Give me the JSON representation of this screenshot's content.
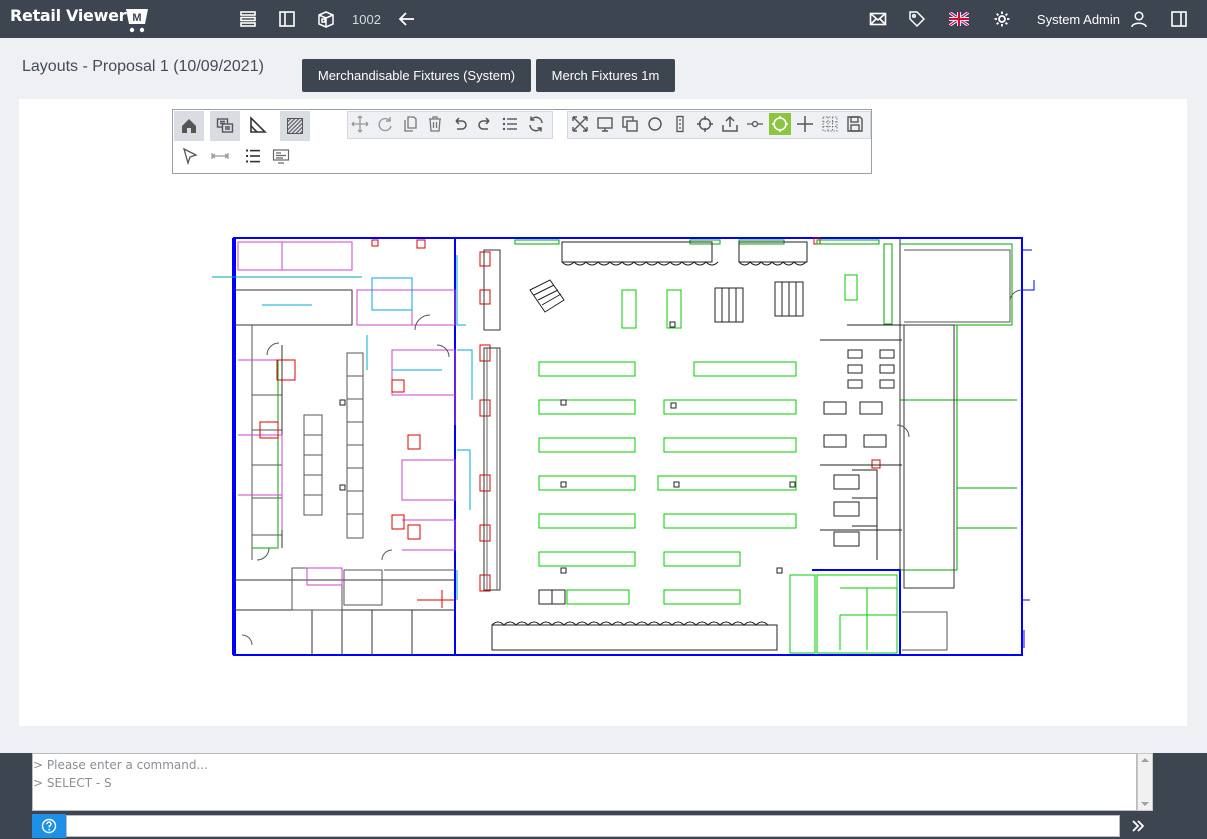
{
  "app": {
    "logo_text": "Retail Viewer",
    "logo_badge": "M",
    "layout_id": "1002",
    "user_name": "System Admin"
  },
  "header": {
    "title": "Layouts - Proposal 1 (10/09/2021)",
    "buttons": [
      "Merchandisable Fixtures (System)",
      "Merch Fixtures 1m"
    ]
  },
  "icons": {
    "top_left": [
      "list-icon",
      "sidebar-panel-icon",
      "package-icon",
      "back-arrow-icon"
    ],
    "top_right": [
      "mail-icon",
      "tag-icon",
      "uk-flag-icon",
      "gear-icon",
      "user-icon",
      "right-panel-icon"
    ],
    "tool_tabs": [
      "home-icon",
      "chat-icon",
      "ruler-triangle-icon",
      "hatch-icon"
    ],
    "tools_row1": [
      "move-icon",
      "rotate-icon",
      "copy-icon",
      "delete-icon",
      "undo-icon",
      "redo-icon",
      "list-icon",
      "refresh-icon",
      "expand-icon",
      "monitor-icon",
      "duplicate-icon",
      "circle-icon",
      "rectangle-icon",
      "target-icon",
      "upload-icon",
      "connector-icon",
      "snap-icon",
      "plus-icon",
      "grid-icon",
      "save-icon"
    ],
    "tools_row2": [
      "pointer-icon",
      "dimension-icon",
      "numbered-list-icon",
      "display-icon"
    ]
  },
  "colors": {
    "topbar": "#3d4550",
    "accent_green": "#8cc63f",
    "plan_blue": "#0000ff",
    "plan_green": "#00cc00",
    "plan_magenta": "#cc44cc",
    "plan_red": "#dd0000",
    "plan_cyan": "#00aadd"
  },
  "command": {
    "log": [
      "> Please enter a command...",
      "> SELECT - S"
    ],
    "input_value": ""
  }
}
